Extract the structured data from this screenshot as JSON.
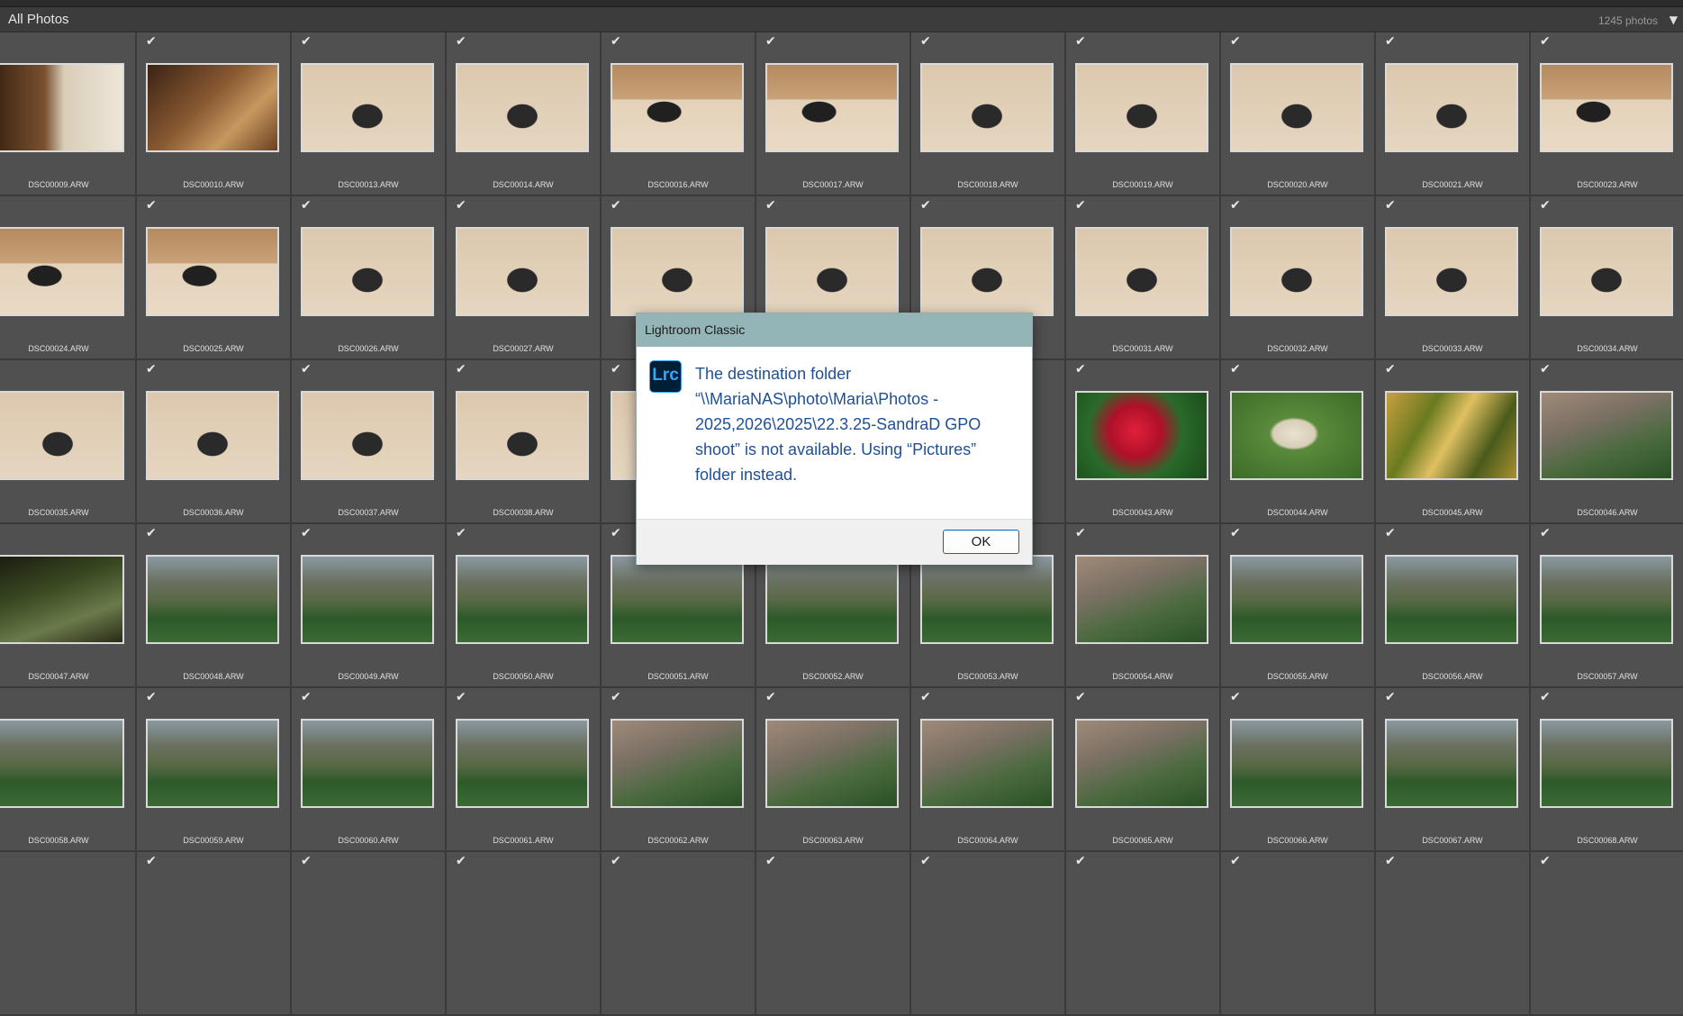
{
  "header": {
    "title": "All Photos",
    "photo_count": "1245 photos",
    "dropdown_icon": "triangle-down-icon"
  },
  "grid": {
    "check_glyph": "✔",
    "rows": [
      [
        "DSC00009.ARW",
        "DSC00010.ARW",
        "DSC00013.ARW",
        "DSC00014.ARW",
        "DSC00016.ARW",
        "DSC00017.ARW",
        "DSC00018.ARW",
        "DSC00019.ARW",
        "DSC00020.ARW",
        "DSC00021.ARW",
        "DSC00023.ARW"
      ],
      [
        "DSC00024.ARW",
        "DSC00025.ARW",
        "DSC00026.ARW",
        "DSC00027.ARW",
        "",
        "",
        "",
        "DSC00031.ARW",
        "DSC00032.ARW",
        "DSC00033.ARW",
        "DSC00034.ARW"
      ],
      [
        "DSC00035.ARW",
        "DSC00036.ARW",
        "DSC00037.ARW",
        "DSC00038.ARW",
        "",
        "",
        "",
        "DSC00043.ARW",
        "DSC00044.ARW",
        "DSC00045.ARW",
        "DSC00046.ARW"
      ],
      [
        "DSC00047.ARW",
        "DSC00048.ARW",
        "DSC00049.ARW",
        "DSC00050.ARW",
        "DSC00051.ARW",
        "DSC00052.ARW",
        "DSC00053.ARW",
        "DSC00054.ARW",
        "DSC00055.ARW",
        "DSC00056.ARW",
        "DSC00057.ARW"
      ],
      [
        "DSC00058.ARW",
        "DSC00059.ARW",
        "DSC00060.ARW",
        "DSC00061.ARW",
        "DSC00062.ARW",
        "DSC00063.ARW",
        "DSC00064.ARW",
        "DSC00065.ARW",
        "DSC00066.ARW",
        "DSC00067.ARW",
        "DSC00068.ARW"
      ],
      [
        "",
        "",
        "",
        "",
        "",
        "",
        "",
        "",
        "",
        "",
        ""
      ]
    ],
    "thumb_styles": [
      [
        "window",
        "room",
        "product",
        "product",
        "box",
        "box",
        "product",
        "product",
        "product",
        "product",
        "box"
      ],
      [
        "box",
        "box",
        "product",
        "product",
        "product",
        "product",
        "product",
        "product",
        "product",
        "product",
        "product"
      ],
      [
        "product",
        "product",
        "product",
        "product",
        "product",
        "",
        "",
        "flower",
        "dog",
        "plant",
        "blur"
      ],
      [
        "dark",
        "forest",
        "forest",
        "forest",
        "forest",
        "forest",
        "forest",
        "blur",
        "forest",
        "forest",
        "forest"
      ],
      [
        "forest",
        "forest",
        "forest",
        "forest",
        "blur",
        "blur",
        "blur",
        "blur",
        "forest",
        "forest",
        "forest"
      ],
      [
        "",
        "",
        "",
        "",
        "",
        "",
        "",
        "",
        "",
        "",
        ""
      ]
    ],
    "hidden_checks": [
      [
        0,
        0
      ],
      [
        1,
        0
      ],
      [
        2,
        0
      ],
      [
        3,
        0
      ],
      [
        4,
        0
      ],
      [
        5,
        0
      ]
    ]
  },
  "dialog": {
    "title": "Lightroom Classic",
    "logo_text": "Lrc",
    "message": "The destination folder “\\\\MariaNAS\\photo\\Maria\\Photos - 2025,2026\\2025\\22.3.25-SandraD GPO shoot” is not available. Using “Pictures” folder instead.",
    "ok_label": "OK"
  }
}
